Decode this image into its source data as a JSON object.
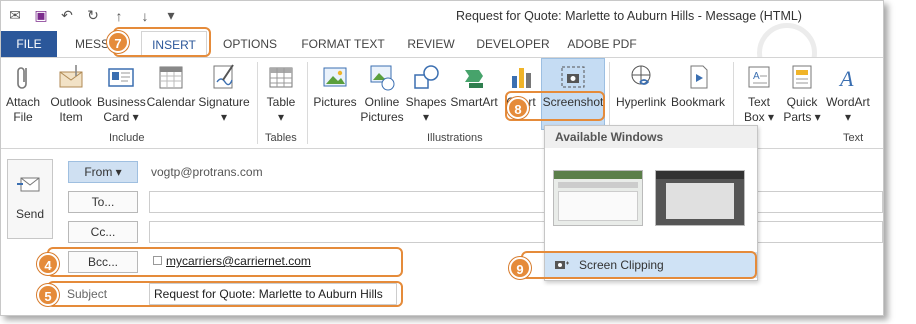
{
  "window": {
    "title": "Request for Quote: Marlette to Auburn Hills - Message (HTML)"
  },
  "quick_access": {
    "qat_icons": [
      "mail-icon",
      "save-icon",
      "undo-icon",
      "redo-icon",
      "up-arrow-icon",
      "down-arrow-icon",
      "customize-icon"
    ]
  },
  "tabs": [
    "FILE",
    "MESS",
    "INSERT",
    "OPTIONS",
    "FORMAT TEXT",
    "REVIEW",
    "DEVELOPER",
    "ADOBE PDF"
  ],
  "ribbon": {
    "buttons": {
      "attach_file": "Attach\nFile",
      "outlook_item": "Outlook\nItem",
      "business_card": "Business\nCard ▾",
      "calendar": "Calendar",
      "signature": "Signature\n▾",
      "table": "Table\n▾",
      "pictures": "Pictures",
      "online_pictures": "Online\nPictures",
      "shapes": "Shapes\n▾",
      "smartart": "SmartArt",
      "chart": "Chart",
      "screenshot": "Screenshot",
      "hyperlink": "Hyperlink",
      "bookmark": "Bookmark",
      "text_box": "Text\nBox ▾",
      "quick_parts": "Quick\nParts ▾",
      "wordart": "WordArt\n▾"
    },
    "groups": {
      "include": "Include",
      "tables": "Tables",
      "illustrations": "Illustrations",
      "text": "Text"
    }
  },
  "dropdown": {
    "header": "Available Windows",
    "clip_label": "Screen Clipping"
  },
  "form": {
    "send": "Send",
    "from_btn": "From ▾",
    "from_value": "vogtp@protrans.com",
    "to_btn": "To...",
    "cc_btn": "Cc...",
    "bcc_btn": "Bcc...",
    "bcc_value": "mycarriers@carriernet.com",
    "subject_label": "Subject",
    "subject_value": "Request for Quote: Marlette to Auburn Hills"
  },
  "callouts": {
    "n7": "7",
    "n8": "8",
    "n9": "9",
    "n4": "4",
    "n5": "5"
  },
  "colors": {
    "accent": "#2b579a",
    "callout": "#e58b3a",
    "selection": "#c5dcf3"
  }
}
